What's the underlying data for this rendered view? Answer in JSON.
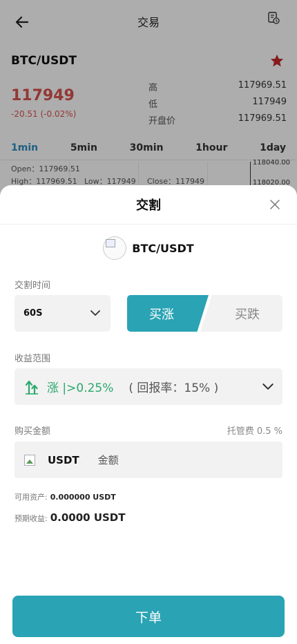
{
  "header": {
    "title": "交易"
  },
  "pair": {
    "name": "BTC/USDT"
  },
  "price": {
    "last": "117949",
    "change": "-20.51 (-0.02%)",
    "stats": [
      {
        "k": "高",
        "v": "117969.51"
      },
      {
        "k": "低",
        "v": "117949"
      },
      {
        "k": "开盘价",
        "v": "117969.51"
      }
    ]
  },
  "periods": [
    "1min",
    "5min",
    "30min",
    "1hour",
    "1day"
  ],
  "ohlc": {
    "open": "Open：117969.51",
    "high": "High：117969.51",
    "low": "Low：117949",
    "close": "Close：117949"
  },
  "price_axis": [
    "118040.00",
    "118020.00"
  ],
  "sheet": {
    "title": "交割",
    "asset": "BTC/USDT",
    "time_label": "交割时间",
    "time_value": "60S",
    "buy_up": "买涨",
    "buy_down": "买跌",
    "range_label": "收益范围",
    "range_text": "涨 |>0.25%",
    "range_rate": "( 回报率：15% )",
    "amount_label": "购买金额",
    "fee": "托管费 0.5 %",
    "amount_unit": "USDT",
    "amount_placeholder": "金额",
    "available_label": "可用资产:",
    "available_value": "0.000000 USDT",
    "expected_label": "预期收益:",
    "expected_value": "0.0000 USDT",
    "submit": "下单"
  },
  "colors": {
    "accent": "#2aa3b4",
    "up": "#2aa86d",
    "down": "#d9534f",
    "active_period": "#2f8ec0"
  }
}
